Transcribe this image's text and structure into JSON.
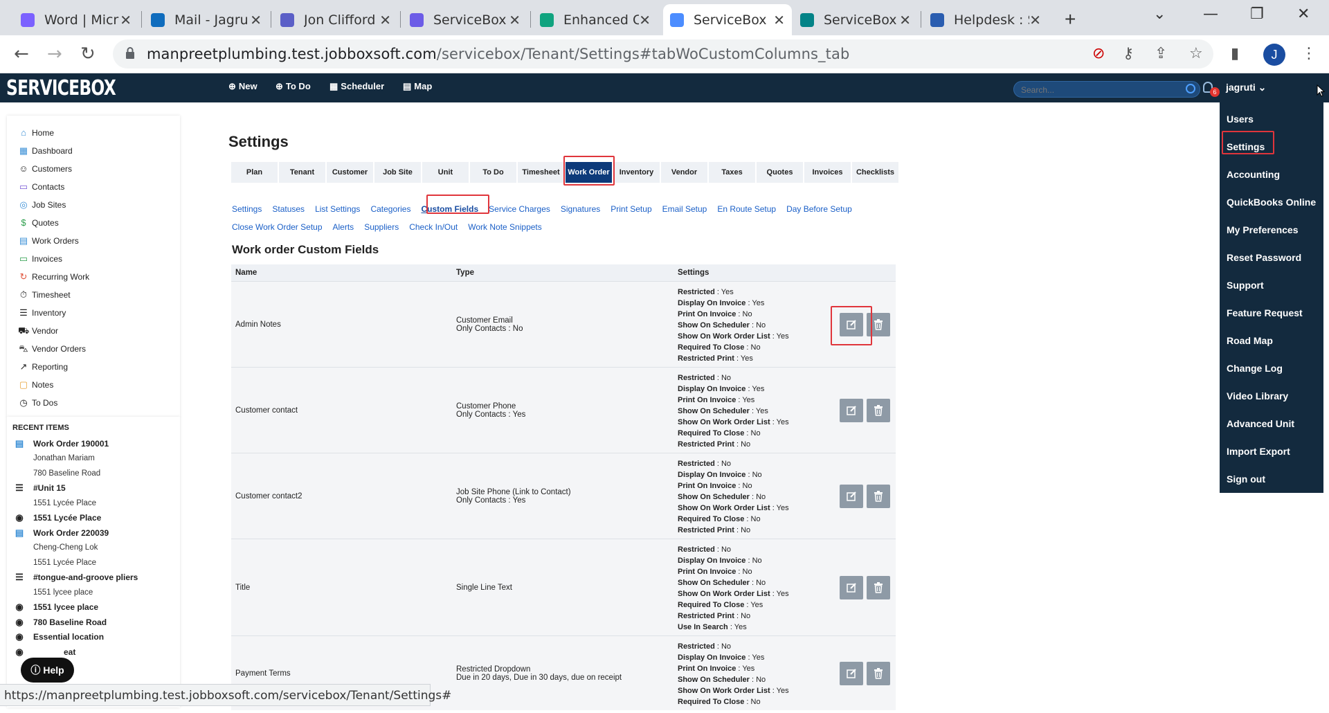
{
  "browser": {
    "tabs": [
      {
        "title": "Word | Micr",
        "color": "#7b61ff"
      },
      {
        "title": "Mail - Jagru",
        "color": "#0f6cbd"
      },
      {
        "title": "Jon Clifford",
        "color": "#5b5fc7"
      },
      {
        "title": "ServiceBox",
        "color": "#6c5ce7"
      },
      {
        "title": "Enhanced C",
        "color": "#10a37f"
      },
      {
        "title": "ServiceBox",
        "color": "#4c8dff"
      },
      {
        "title": "ServiceBox",
        "color": "#038387"
      },
      {
        "title": "Helpdesk : S",
        "color": "#2a5db0"
      }
    ],
    "active_tab_index": 5,
    "url_host": "manpreetplumbing.test.jobboxsoft.com",
    "url_path": "/servicebox/Tenant/Settings#tabWoCustomColumns_tab",
    "profile_initial": "J",
    "status_url": "https://manpreetplumbing.test.jobboxsoft.com/servicebox/Tenant/Settings#"
  },
  "appnav": {
    "logo": "SERVICEBOX",
    "links": {
      "new": "New",
      "todo": "To Do",
      "scheduler": "Scheduler",
      "map": "Map"
    },
    "search_placeholder": "Search...",
    "notifications": "6",
    "user": "jagruti"
  },
  "sidebar": {
    "items": [
      "Home",
      "Dashboard",
      "Customers",
      "Contacts",
      "Job Sites",
      "Quotes",
      "Work Orders",
      "Invoices",
      "Recurring Work",
      "Timesheet",
      "Inventory",
      "Vendor",
      "Vendor Orders",
      "Reporting",
      "Notes",
      "To Dos"
    ],
    "recent_title": "RECENT ITEMS",
    "recent": {
      "wo1": "Work Order 190001",
      "wo1_a": "Jonathan Mariam",
      "wo1_b": "780 Baseline Road",
      "unit1": "#Unit 15",
      "unit1_a": "1551 Lycée Place",
      "site1": "1551 Lycée Place",
      "wo2": "Work Order 220039",
      "wo2_a": "Cheng-Cheng Lok",
      "wo2_b": "1551 Lycée Place",
      "unit2": "#tongue-and-groove pliers",
      "unit2_a": "1551 lycee place",
      "site2": "1551 lycee place",
      "site3": "780 Baseline Road",
      "site4": "Essential location",
      "site5": "eat"
    }
  },
  "help_label": "Help",
  "content": {
    "title": "Settings",
    "tabs": [
      "Plan",
      "Tenant",
      "Customer",
      "Job Site",
      "Unit",
      "To Do",
      "Timesheet",
      "Work Order",
      "Inventory",
      "Vendor",
      "Taxes",
      "Quotes",
      "Invoices",
      "Checklists"
    ],
    "active_tab": "Work Order",
    "sublinks_row1": [
      "Settings",
      "Statuses",
      "List Settings",
      "Categories",
      "Custom Fields",
      "Service Charges",
      "Signatures",
      "Print Setup",
      "Email Setup",
      "En Route Setup",
      "Day Before Setup"
    ],
    "sublinks_row2": [
      "Close Work Order Setup",
      "Alerts",
      "Suppliers",
      "Check In/Out",
      "Work Note Snippets"
    ],
    "active_sublink": "Custom Fields",
    "section_title": "Work order Custom Fields",
    "columns": [
      "Name",
      "Type",
      "Settings"
    ],
    "rows": [
      {
        "name": "Admin Notes",
        "type": "Customer Email",
        "type2": "Only Contacts : No",
        "settings": [
          [
            "Restricted",
            "Yes"
          ],
          [
            "Display On Invoice",
            "Yes"
          ],
          [
            "Print On Invoice",
            "No"
          ],
          [
            "Show On Scheduler",
            "No"
          ],
          [
            "Show On Work Order List",
            "Yes"
          ],
          [
            "Required To Close",
            "No"
          ],
          [
            "Restricted Print",
            "Yes"
          ]
        ]
      },
      {
        "name": "Customer contact",
        "type": "Customer Phone",
        "type2": "Only Contacts : Yes",
        "settings": [
          [
            "Restricted",
            "No"
          ],
          [
            "Display On Invoice",
            "Yes"
          ],
          [
            "Print On Invoice",
            "Yes"
          ],
          [
            "Show On Scheduler",
            "Yes"
          ],
          [
            "Show On Work Order List",
            "Yes"
          ],
          [
            "Required To Close",
            "No"
          ],
          [
            "Restricted Print",
            "No"
          ]
        ]
      },
      {
        "name": "Customer contact2",
        "type": "Job Site Phone (Link to Contact)",
        "type2": "Only Contacts : Yes",
        "settings": [
          [
            "Restricted",
            "No"
          ],
          [
            "Display On Invoice",
            "No"
          ],
          [
            "Print On Invoice",
            "No"
          ],
          [
            "Show On Scheduler",
            "No"
          ],
          [
            "Show On Work Order List",
            "Yes"
          ],
          [
            "Required To Close",
            "No"
          ],
          [
            "Restricted Print",
            "No"
          ]
        ]
      },
      {
        "name": "Title",
        "type": "Single Line Text",
        "type2": "",
        "settings": [
          [
            "Restricted",
            "No"
          ],
          [
            "Display On Invoice",
            "No"
          ],
          [
            "Print On Invoice",
            "No"
          ],
          [
            "Show On Scheduler",
            "No"
          ],
          [
            "Show On Work Order List",
            "Yes"
          ],
          [
            "Required To Close",
            "Yes"
          ],
          [
            "Restricted Print",
            "No"
          ],
          [
            "Use In Search",
            "Yes"
          ]
        ]
      },
      {
        "name": "Payment Terms",
        "type": "Restricted Dropdown",
        "type2": "Due in 20 days, Due in 30 days, due on receipt",
        "settings": [
          [
            "Restricted",
            "No"
          ],
          [
            "Display On Invoice",
            "Yes"
          ],
          [
            "Print On Invoice",
            "Yes"
          ],
          [
            "Show On Scheduler",
            "No"
          ],
          [
            "Show On Work Order List",
            "Yes"
          ],
          [
            "Required To Close",
            "No"
          ]
        ]
      }
    ]
  },
  "user_menu": [
    "Users",
    "Settings",
    "Accounting",
    "QuickBooks Online",
    "My Preferences",
    "Reset Password",
    "Support",
    "Feature Request",
    "Road Map",
    "Change Log",
    "Video Library",
    "Advanced Unit",
    "Import Export",
    "Sign out"
  ],
  "colors": {
    "nav_bg": "#132a3e",
    "active_tab": "#0d3a7a",
    "highlight": "#e0353b",
    "link": "#1a5fc7"
  }
}
